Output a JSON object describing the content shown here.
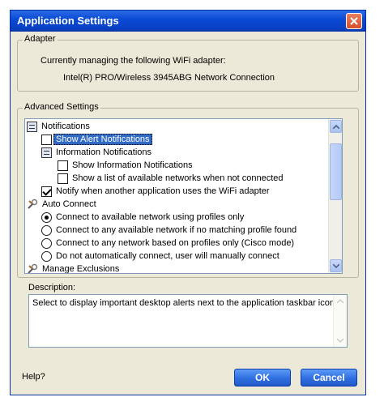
{
  "window": {
    "title": "Application Settings",
    "close_icon": "close-icon"
  },
  "adapter": {
    "label": "Adapter",
    "line1": "Currently managing the following WiFi adapter:",
    "line2": "Intel(R) PRO/Wireless 3945ABG Network Connection"
  },
  "advanced": {
    "label": "Advanced Settings",
    "items": [
      {
        "icon": "notifications-node-icon",
        "label": "Notifications"
      },
      {
        "icon": "checkbox-unchecked-icon",
        "label": "Show Alert Notifications",
        "checked": false,
        "selected": true
      },
      {
        "icon": "information-node-icon",
        "label": "Information Notifications"
      },
      {
        "icon": "checkbox-unchecked-icon",
        "label": "Show Information Notifications",
        "checked": false
      },
      {
        "icon": "checkbox-unchecked-icon",
        "label": "Show a list of available networks when not connected",
        "checked": false
      },
      {
        "icon": "checkbox-checked-icon",
        "label": "Notify when another application uses the WiFi adapter",
        "checked": true
      },
      {
        "icon": "auto-connect-tools-icon",
        "label": "Auto Connect"
      },
      {
        "icon": "radio-selected-icon",
        "label": "Connect to available network using profiles only",
        "selected": true
      },
      {
        "icon": "radio-unselected-icon",
        "label": "Connect to any available network if no matching profile found"
      },
      {
        "icon": "radio-unselected-icon",
        "label": "Connect to any network based on profiles only (Cisco mode)"
      },
      {
        "icon": "radio-unselected-icon",
        "label": "Do not automatically connect, user will manually connect"
      },
      {
        "icon": "manage-exclusions-tools-icon",
        "label": "Manage Exclusions"
      }
    ]
  },
  "description": {
    "label": "Description:",
    "text": "Select to display important desktop alerts next to the application taskbar icon."
  },
  "footer": {
    "help": "Help?",
    "ok": "OK",
    "cancel": "Cancel"
  },
  "colors": {
    "titlebar": "#0a4bd6",
    "selection": "#316ac5",
    "button": "#2f6fe0",
    "close": "#d4502e"
  }
}
